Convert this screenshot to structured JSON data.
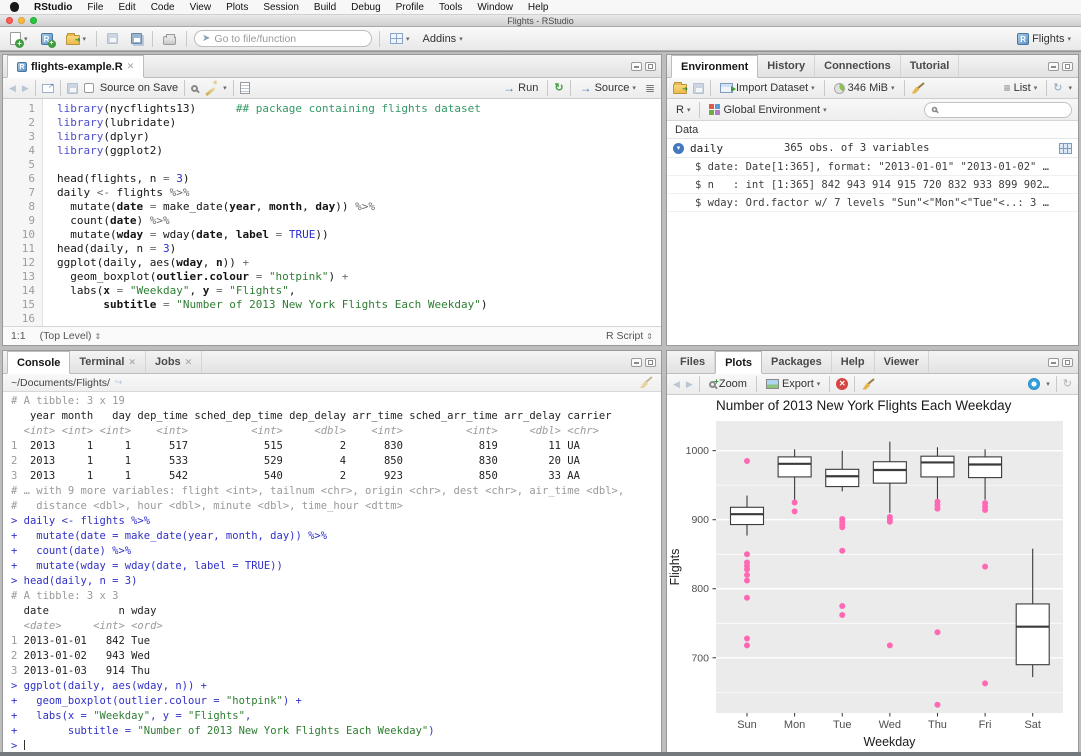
{
  "menubar": {
    "items": [
      "RStudio",
      "File",
      "Edit",
      "Code",
      "View",
      "Plots",
      "Session",
      "Build",
      "Debug",
      "Profile",
      "Tools",
      "Window",
      "Help"
    ]
  },
  "titlebar": {
    "title": "Flights - RStudio"
  },
  "toolbar": {
    "goto_placeholder": "Go to file/function",
    "addins_label": "Addins",
    "project_label": "Flights"
  },
  "editor": {
    "tab": "flights-example.R",
    "toolbar": {
      "source_on_save": "Source on Save",
      "run_label": "Run",
      "source_label": "Source"
    },
    "status": {
      "position": "1:1",
      "scope": "(Top Level)",
      "file_type": "R Script"
    },
    "lines": [
      [
        [
          "k",
          "library"
        ],
        [
          "p",
          "(nycflights13)"
        ],
        [
          "p",
          "      "
        ],
        [
          "c",
          "## package containing flights dataset"
        ]
      ],
      [
        [
          "k",
          "library"
        ],
        [
          "p",
          "(lubridate)"
        ]
      ],
      [
        [
          "k",
          "library"
        ],
        [
          "p",
          "(dplyr)"
        ]
      ],
      [
        [
          "k",
          "library"
        ],
        [
          "p",
          "(ggplot2)"
        ]
      ],
      [],
      [
        [
          "p",
          "head(flights, n "
        ],
        [
          "o",
          "="
        ],
        [
          "p",
          " "
        ],
        [
          "n",
          "3"
        ],
        [
          "p",
          ")"
        ]
      ],
      [
        [
          "p",
          "daily "
        ],
        [
          "o",
          "<-"
        ],
        [
          "p",
          " flights "
        ],
        [
          "o",
          "%>%"
        ]
      ],
      [
        [
          "p",
          "  mutate("
        ],
        [
          "a",
          "date"
        ],
        [
          "p",
          " "
        ],
        [
          "o",
          "="
        ],
        [
          "p",
          " make_date("
        ],
        [
          "a",
          "year"
        ],
        [
          "p",
          ", "
        ],
        [
          "a",
          "month"
        ],
        [
          "p",
          ", "
        ],
        [
          "a",
          "day"
        ],
        [
          "p",
          ")) "
        ],
        [
          "o",
          "%>%"
        ]
      ],
      [
        [
          "p",
          "  count("
        ],
        [
          "a",
          "date"
        ],
        [
          "p",
          ") "
        ],
        [
          "o",
          "%>%"
        ]
      ],
      [
        [
          "p",
          "  mutate("
        ],
        [
          "a",
          "wday"
        ],
        [
          "p",
          " "
        ],
        [
          "o",
          "="
        ],
        [
          "p",
          " wday("
        ],
        [
          "a",
          "date"
        ],
        [
          "p",
          ", "
        ],
        [
          "a",
          "label"
        ],
        [
          "p",
          " "
        ],
        [
          "o",
          "="
        ],
        [
          "p",
          " "
        ],
        [
          "n",
          "TRUE"
        ],
        [
          "p",
          "))"
        ]
      ],
      [
        [
          "p",
          "head(daily, n "
        ],
        [
          "o",
          "="
        ],
        [
          "p",
          " "
        ],
        [
          "n",
          "3"
        ],
        [
          "p",
          ")"
        ]
      ],
      [
        [
          "p",
          "ggplot(daily, aes("
        ],
        [
          "a",
          "wday"
        ],
        [
          "p",
          ", "
        ],
        [
          "a",
          "n"
        ],
        [
          "p",
          ")) "
        ],
        [
          "o",
          "+"
        ]
      ],
      [
        [
          "p",
          "  geom_boxplot("
        ],
        [
          "a",
          "outlier.colour"
        ],
        [
          "p",
          " "
        ],
        [
          "o",
          "="
        ],
        [
          "p",
          " "
        ],
        [
          "s",
          "\"hotpink\""
        ],
        [
          "p",
          ") "
        ],
        [
          "o",
          "+"
        ]
      ],
      [
        [
          "p",
          "  labs("
        ],
        [
          "a",
          "x"
        ],
        [
          "p",
          " "
        ],
        [
          "o",
          "="
        ],
        [
          "p",
          " "
        ],
        [
          "s",
          "\"Weekday\""
        ],
        [
          "p",
          ", "
        ],
        [
          "a",
          "y"
        ],
        [
          "p",
          " "
        ],
        [
          "o",
          "="
        ],
        [
          "p",
          " "
        ],
        [
          "s",
          "\"Flights\""
        ],
        [
          "p",
          ","
        ]
      ],
      [
        [
          "p",
          "       "
        ],
        [
          "a",
          "subtitle"
        ],
        [
          "p",
          " "
        ],
        [
          "o",
          "="
        ],
        [
          "p",
          " "
        ],
        [
          "s",
          "\"Number of 2013 New York Flights Each Weekday\""
        ],
        [
          "p",
          ")"
        ]
      ],
      []
    ]
  },
  "environment": {
    "tabs": [
      "Environment",
      "History",
      "Connections",
      "Tutorial"
    ],
    "toolbar": {
      "import_label": "Import Dataset",
      "memory_label": "346 MiB",
      "list_label": "List"
    },
    "scope_row": {
      "r_label": "R",
      "scope_label": "Global Environment"
    },
    "data_header": "Data",
    "object": {
      "name": "daily",
      "summary": "365 obs. of 3 variables"
    },
    "fields": [
      "$ date: Date[1:365], format: \"2013-01-01\" \"2013-01-02\" …",
      "$ n   : int [1:365] 842 943 914 915 720 832 933 899 902…",
      "$ wday: Ord.factor w/ 7 levels \"Sun\"<\"Mon\"<\"Tue\"<..: 3 …"
    ]
  },
  "console": {
    "tabs": [
      "Console",
      "Terminal",
      "Jobs"
    ],
    "path": "~/Documents/Flights/",
    "lines": [
      [
        [
          "mut",
          "# A tibble: 3 x 19"
        ]
      ],
      [
        [
          "out",
          "   year month   day dep_time sched_dep_time dep_delay arr_time sched_arr_time arr_delay carrier"
        ]
      ],
      [
        [
          "muti",
          "  <int> <int> <int>    <int>          <int>     <dbl>    <int>          <int>     <dbl> <chr>"
        ]
      ],
      [
        [
          "mut",
          "1"
        ],
        [
          "out",
          "  2013     1     1      517            515         2      830            819        11 UA"
        ]
      ],
      [
        [
          "mut",
          "2"
        ],
        [
          "out",
          "  2013     1     1      533            529         4      850            830        20 UA"
        ]
      ],
      [
        [
          "mut",
          "3"
        ],
        [
          "out",
          "  2013     1     1      542            540         2      923            850        33 AA"
        ]
      ],
      [
        [
          "mut",
          "# … with 9 more variables: flight <int>, tailnum <chr>, origin <chr>, dest <chr>, air_time <dbl>,"
        ]
      ],
      [
        [
          "mut",
          "#   distance <dbl>, hour <dbl>, minute <dbl>, time_hour <dttm>"
        ]
      ],
      [
        [
          "in",
          "> daily <- flights %>%"
        ]
      ],
      [
        [
          "in",
          "+   mutate(date = make_date(year, month, day)) %>%"
        ]
      ],
      [
        [
          "in",
          "+   count(date) %>%"
        ]
      ],
      [
        [
          "in",
          "+   mutate(wday = wday(date, label = TRUE))"
        ]
      ],
      [
        [
          "in",
          "> head(daily, n = 3)"
        ]
      ],
      [
        [
          "mut",
          "# A tibble: 3 x 3"
        ]
      ],
      [
        [
          "out",
          "  date           n wday"
        ]
      ],
      [
        [
          "muti",
          "  <date>     <int> <ord>"
        ]
      ],
      [
        [
          "mut",
          "1"
        ],
        [
          "out",
          " 2013-01-01   842 Tue"
        ]
      ],
      [
        [
          "mut",
          "2"
        ],
        [
          "out",
          " 2013-01-02   943 Wed"
        ]
      ],
      [
        [
          "mut",
          "3"
        ],
        [
          "out",
          " 2013-01-03   914 Thu"
        ]
      ],
      [
        [
          "in",
          "> ggplot(daily, aes(wday, n)) +"
        ]
      ],
      [
        [
          "in",
          "+   geom_boxplot(outlier.colour = "
        ],
        [
          "s",
          "\"hotpink\""
        ],
        [
          "in",
          ") +"
        ]
      ],
      [
        [
          "in",
          "+   labs(x = "
        ],
        [
          "s",
          "\"Weekday\""
        ],
        [
          "in",
          ", y = "
        ],
        [
          "s",
          "\"Flights\""
        ],
        [
          "in",
          ","
        ]
      ],
      [
        [
          "in",
          "+        subtitle = "
        ],
        [
          "s",
          "\"Number of 2013 New York Flights Each Weekday\""
        ],
        [
          "in",
          ")"
        ]
      ],
      [
        [
          "in",
          "> "
        ]
      ]
    ]
  },
  "plots": {
    "tabs": [
      "Files",
      "Plots",
      "Packages",
      "Help",
      "Viewer"
    ],
    "toolbar": {
      "zoom_label": "Zoom",
      "export_label": "Export"
    }
  },
  "chart_data": {
    "type": "boxplot",
    "title": "Number of 2013 New York Flights Each Weekday",
    "xlabel": "Weekday",
    "ylabel": "Flights",
    "categories": [
      "Sun",
      "Mon",
      "Tue",
      "Wed",
      "Thu",
      "Fri",
      "Sat"
    ],
    "ylim": [
      620,
      1043
    ],
    "yticks": [
      700,
      800,
      900,
      1000
    ],
    "yticks_minor": [
      650,
      750,
      850,
      950
    ],
    "grid": true,
    "panel_bg": "#ebebeb",
    "box_fill": "#ffffff",
    "box_stroke": "#3a3a3a",
    "outlier_color": "#FF69B4",
    "series": [
      {
        "category": "Sun",
        "whisker_low": 877,
        "q1": 893,
        "median": 908,
        "q3": 918,
        "whisker_high": 935,
        "outliers": [
          985,
          850,
          838,
          833,
          828,
          820,
          812,
          787,
          728,
          718
        ]
      },
      {
        "category": "Mon",
        "whisker_low": 928,
        "q1": 962,
        "median": 981,
        "q3": 991,
        "whisker_high": 1002,
        "outliers": [
          925,
          912
        ]
      },
      {
        "category": "Tue",
        "whisker_low": 941,
        "q1": 948,
        "median": 963,
        "q3": 973,
        "whisker_high": 1000,
        "outliers": [
          901,
          897,
          893,
          889,
          855,
          775,
          762
        ]
      },
      {
        "category": "Wed",
        "whisker_low": 910,
        "q1": 953,
        "median": 972,
        "q3": 984,
        "whisker_high": 1013,
        "outliers": [
          904,
          900,
          897,
          718
        ]
      },
      {
        "category": "Thu",
        "whisker_low": 929,
        "q1": 962,
        "median": 983,
        "q3": 992,
        "whisker_high": 1005,
        "outliers": [
          926,
          921,
          916,
          737,
          632
        ]
      },
      {
        "category": "Fri",
        "whisker_low": 929,
        "q1": 961,
        "median": 980,
        "q3": 991,
        "whisker_high": 1002,
        "outliers": [
          924,
          919,
          914,
          832,
          663
        ]
      },
      {
        "category": "Sat",
        "whisker_low": 672,
        "q1": 690,
        "median": 745,
        "q3": 778,
        "whisker_high": 858,
        "outliers": []
      }
    ]
  }
}
